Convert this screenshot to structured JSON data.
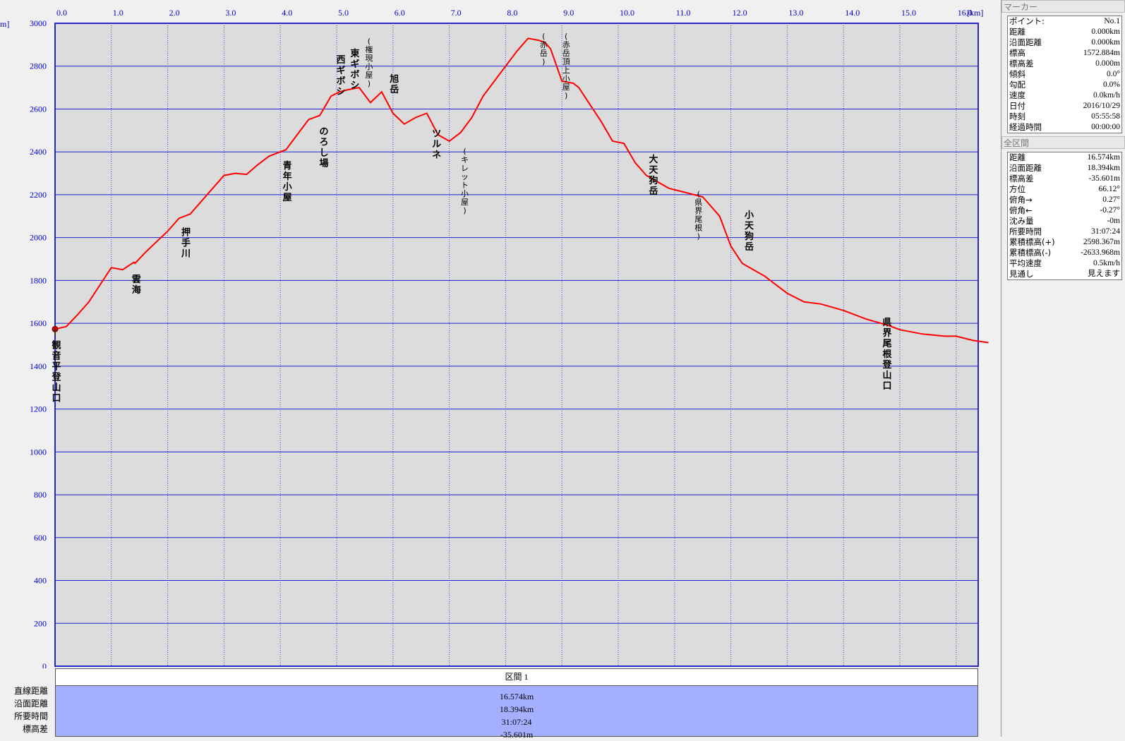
{
  "chart_data": {
    "type": "line",
    "xlabel": "",
    "x_unit": "[km]",
    "y_unit": "m]",
    "xlim": [
      0,
      16.574
    ],
    "ylim": [
      0,
      3000
    ],
    "x_ticks": [
      "0.0",
      "1.0",
      "2.0",
      "3.0",
      "4.0",
      "5.0",
      "6.0",
      "7.0",
      "8.0",
      "9.0",
      "10.0",
      "11.0",
      "12.0",
      "13.0",
      "14.0",
      "15.0",
      "16.0"
    ],
    "y_ticks": [
      "0",
      "200",
      "400",
      "600",
      "800",
      "1000",
      "1200",
      "1400",
      "1600",
      "1800",
      "2000",
      "2200",
      "2400",
      "2600",
      "2800",
      "3000"
    ],
    "grid": true,
    "line_color": "#ff0000",
    "series": [
      {
        "x": [
          0.0,
          0.2,
          0.4,
          0.6,
          0.8,
          1.0,
          1.2,
          1.4,
          1.42,
          1.6,
          1.8,
          2.0,
          2.2,
          2.4,
          2.6,
          2.8,
          3.0,
          3.2,
          3.4,
          3.6,
          3.8,
          4.0,
          4.1,
          4.3,
          4.5,
          4.7,
          4.9,
          5.05,
          5.2,
          5.4,
          5.6,
          5.8,
          6.0,
          6.2,
          6.4,
          6.6,
          6.8,
          7.0,
          7.2,
          7.4,
          7.6,
          7.8,
          8.0,
          8.2,
          8.4,
          8.6,
          8.7,
          8.8,
          9.0,
          9.2,
          9.3,
          9.5,
          9.7,
          9.9,
          10.1,
          10.3,
          10.5,
          10.7,
          10.9,
          11.2,
          11.5,
          11.8,
          12.0,
          12.2,
          12.4,
          12.6,
          12.8,
          13.0,
          13.3,
          13.6,
          14.0,
          14.4,
          14.8,
          15.0,
          15.4,
          15.8,
          16.0,
          16.3,
          16.574
        ],
        "y": [
          1573,
          1585,
          1640,
          1700,
          1780,
          1860,
          1850,
          1885,
          1880,
          1930,
          1980,
          2030,
          2090,
          2110,
          2170,
          2230,
          2290,
          2300,
          2295,
          2340,
          2380,
          2400,
          2410,
          2480,
          2550,
          2570,
          2660,
          2680,
          2690,
          2700,
          2630,
          2680,
          2580,
          2530,
          2560,
          2580,
          2480,
          2450,
          2490,
          2560,
          2660,
          2730,
          2800,
          2870,
          2930,
          2920,
          2910,
          2880,
          2730,
          2720,
          2700,
          2620,
          2540,
          2450,
          2440,
          2350,
          2290,
          2260,
          2230,
          2210,
          2190,
          2100,
          1960,
          1880,
          1850,
          1820,
          1780,
          1740,
          1700,
          1690,
          1660,
          1620,
          1590,
          1570,
          1550,
          1540,
          1540,
          1520,
          1510
        ]
      }
    ],
    "annotations": [
      {
        "x": 0.0,
        "y": 1573,
        "text": "観音平登山口"
      },
      {
        "x": 1.42,
        "y": 1880,
        "text": "雲海"
      },
      {
        "x": 2.3,
        "y": 2100,
        "text": "押手川"
      },
      {
        "x": 4.1,
        "y": 2410,
        "text": "青年小屋"
      },
      {
        "x": 4.75,
        "y": 2570,
        "text": "のろし場"
      },
      {
        "x": 5.05,
        "y": 2660,
        "text": "西ギボシ"
      },
      {
        "x": 5.3,
        "y": 2690,
        "text": "東ギボシ"
      },
      {
        "x": 5.55,
        "y": 2700,
        "text": "(権現小屋)"
      },
      {
        "x": 6.0,
        "y": 2670,
        "text": "旭岳"
      },
      {
        "x": 6.75,
        "y": 2560,
        "text": "ツルネ"
      },
      {
        "x": 7.25,
        "y": 2470,
        "text": "(キレット小屋)"
      },
      {
        "x": 8.65,
        "y": 2930,
        "text": "(赤岳)"
      },
      {
        "x": 9.05,
        "y": 2880,
        "text": "(赤岳頂上小屋)"
      },
      {
        "x": 10.6,
        "y": 2440,
        "text": "大天狗岳"
      },
      {
        "x": 11.4,
        "y": 2270,
        "text": "(県界尾根)"
      },
      {
        "x": 12.3,
        "y": 2180,
        "text": "小天狗岳"
      },
      {
        "x": 14.75,
        "y": 1680,
        "text": "県界尾根登山口"
      }
    ]
  },
  "bottom_panel": {
    "header": "区間 1",
    "labels": [
      "直線距離",
      "沿面距離",
      "所要時間",
      "標高差"
    ],
    "values": [
      "16.574km",
      "18.394km",
      "31:07:24",
      "-35.601m"
    ]
  },
  "right_panel": {
    "marker_title": "マーカー",
    "marker_rows": [
      {
        "label": "ポイント:",
        "value": "No.1"
      },
      {
        "label": "距離",
        "value": "0.000km"
      },
      {
        "label": "沿面距離",
        "value": "0.000km"
      },
      {
        "label": "標高",
        "value": "1572.884m"
      },
      {
        "label": "標高差",
        "value": "0.000m"
      },
      {
        "label": "傾斜",
        "value": "0.0°"
      },
      {
        "label": "勾配",
        "value": "0.0%"
      },
      {
        "label": "速度",
        "value": "0.0km/h"
      },
      {
        "label": "日付",
        "value": "2016/10/29"
      },
      {
        "label": "時刻",
        "value": "05:55:58"
      },
      {
        "label": "経過時間",
        "value": "00:00:00"
      }
    ],
    "section_title": "全区間",
    "section_rows": [
      {
        "label": "距離",
        "value": "16.574km"
      },
      {
        "label": "沿面距離",
        "value": "18.394km"
      },
      {
        "label": "標高差",
        "value": "-35.601m"
      },
      {
        "label": "方位",
        "value": "66.12°"
      },
      {
        "label": "俯角→",
        "value": "0.27°"
      },
      {
        "label": "俯角←",
        "value": "-0.27°"
      },
      {
        "label": "沈み量",
        "value": "-0m"
      },
      {
        "label": "所要時間",
        "value": "31:07:24"
      },
      {
        "label": "累積標高(+)",
        "value": "2598.367m"
      },
      {
        "label": "累積標高(-)",
        "value": "-2633.968m"
      },
      {
        "label": "平均速度",
        "value": "0.5km/h"
      },
      {
        "label": "見通し",
        "value": "見えます"
      }
    ]
  }
}
